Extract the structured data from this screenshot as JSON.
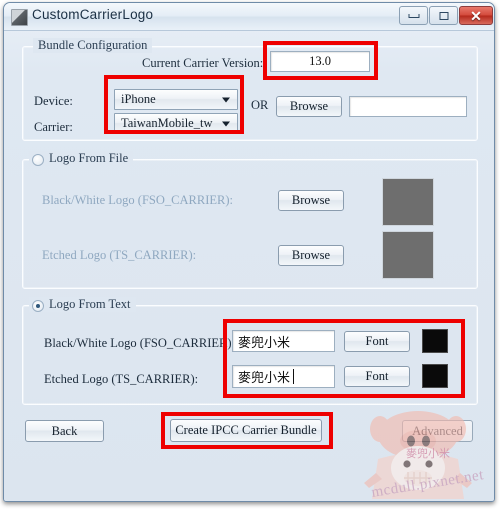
{
  "window": {
    "title": "CustomCarrierLogo",
    "icon": "app-logo-icon",
    "controls": {
      "minimize": "minimize-icon",
      "maximize": "maximize-icon",
      "close": "✕"
    }
  },
  "bundle_configuration": {
    "title": "Bundle Configuration",
    "version_label": "Current Carrier Version:",
    "version_value": "13.0",
    "device_label": "Device:",
    "device_value": "iPhone",
    "carrier_label": "Carrier:",
    "carrier_value": "TaiwanMobile_tw",
    "or_label": "OR",
    "browse_label": "Browse",
    "path_value": ""
  },
  "logo_from_file": {
    "title": "Logo From File",
    "selected": false,
    "bw_label": "Black/White Logo  (FSO_CARRIER):",
    "bw_browse_label": "Browse",
    "etched_label": "Etched Logo (TS_CARRIER):",
    "etched_browse_label": "Browse",
    "preview_color": "#6e6e6e"
  },
  "logo_from_text": {
    "title": "Logo From Text",
    "selected": true,
    "bw_label": "Black/White Logo  (FSO_CARRIER):",
    "bw_value": "麥兜小米",
    "bw_font_label": "Font",
    "bw_color": "#0a0a0a",
    "etched_label": "Etched Logo (TS_CARRIER):",
    "etched_value": "麥兜小米",
    "etched_font_label": "Font",
    "etched_color": "#0a0a0a"
  },
  "actions": {
    "back_label": "Back",
    "create_label": "Create IPCC Carrier Bundle",
    "advanced_label": "Advanced"
  },
  "annotations": {
    "highlight_color": "#ee0000"
  },
  "watermark": {
    "url": "mcdull.pixnet.net",
    "caption": "麥兜小米"
  }
}
